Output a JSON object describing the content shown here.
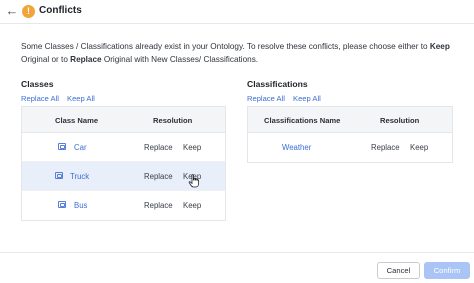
{
  "header": {
    "back_icon": "arrow-left-icon",
    "warning_icon": "exclamation-icon",
    "warning_glyph": "!",
    "title": "Conflicts"
  },
  "description": {
    "part1": "Some Classes / Classifications already exist in your Ontology. To resolve these conflicts, please choose either to ",
    "keep": "Keep",
    "part2": " Original or to ",
    "replace": "Replace",
    "part3": " Original with New Classes/ Classifications."
  },
  "classes": {
    "title": "Classes",
    "replace_all": "Replace All",
    "keep_all": "Keep All",
    "columns": [
      "Class Name",
      "Resolution"
    ],
    "rows": [
      {
        "name": "Car",
        "replace": "Replace",
        "keep": "Keep"
      },
      {
        "name": "Truck",
        "replace": "Replace",
        "keep": "Keep"
      },
      {
        "name": "Bus",
        "replace": "Replace",
        "keep": "Keep"
      }
    ]
  },
  "classifications": {
    "title": "Classifications",
    "replace_all": "Replace All",
    "keep_all": "Keep All",
    "columns": [
      "Classifications Name",
      "Resolution"
    ],
    "rows": [
      {
        "name": "Weather",
        "replace": "Replace",
        "keep": "Keep"
      }
    ]
  },
  "footer": {
    "cancel": "Cancel",
    "confirm": "Confirm"
  },
  "colors": {
    "accent": "#3d6fd6",
    "warning": "#f2a33a",
    "confirm_disabled": "#a9c4f5",
    "row_hover": "#e9eefb"
  }
}
